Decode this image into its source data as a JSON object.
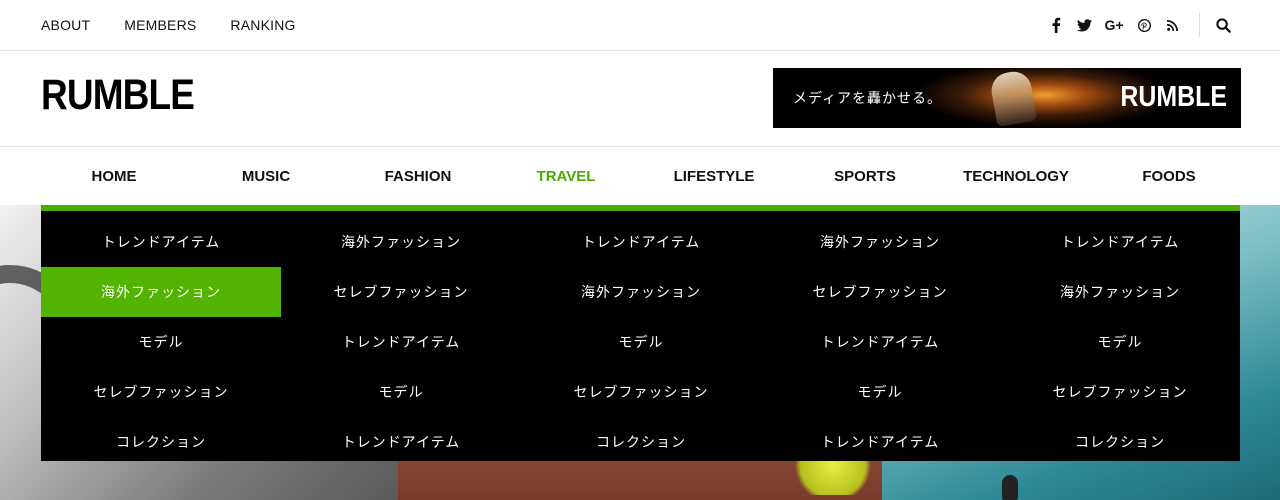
{
  "topbar": {
    "links": [
      "ABOUT",
      "MEMBERS",
      "RANKING"
    ],
    "social": [
      {
        "icon": "facebook-icon",
        "glyph": "f"
      },
      {
        "icon": "twitter-icon",
        "glyph": "🐦"
      },
      {
        "icon": "google-plus-icon",
        "glyph": "G+"
      },
      {
        "icon": "pinterest-icon",
        "glyph": "℗"
      },
      {
        "icon": "rss-icon",
        "glyph": "⁂"
      }
    ],
    "search_icon": "search-icon"
  },
  "header": {
    "logo": "RUMBLE",
    "banner": {
      "tagline": "メディアを轟かせる。",
      "logo": "RUMBLE"
    }
  },
  "nav": {
    "items": [
      "HOME",
      "MUSIC",
      "FASHION",
      "TRAVEL",
      "LIFESTYLE",
      "SPORTS",
      "TECHNOLOGY",
      "FOODS"
    ],
    "active": "TRAVEL",
    "active_color": "#4caa00"
  },
  "mega_menu": {
    "accent_color": "#4caa00",
    "columns": [
      [
        "トレンドアイテム",
        "海外ファッション",
        "モデル",
        "セレブファッション",
        "コレクション"
      ],
      [
        "海外ファッション",
        "セレブファッション",
        "トレンドアイテム",
        "モデル",
        "トレンドアイテム"
      ],
      [
        "トレンドアイテム",
        "海外ファッション",
        "モデル",
        "セレブファッション",
        "コレクション"
      ],
      [
        "海外ファッション",
        "セレブファッション",
        "トレンドアイテム",
        "モデル",
        "トレンドアイテム"
      ],
      [
        "トレンドアイテム",
        "海外ファッション",
        "モデル",
        "セレブファッション",
        "コレクション"
      ]
    ],
    "highlighted": "海外ファッション"
  }
}
